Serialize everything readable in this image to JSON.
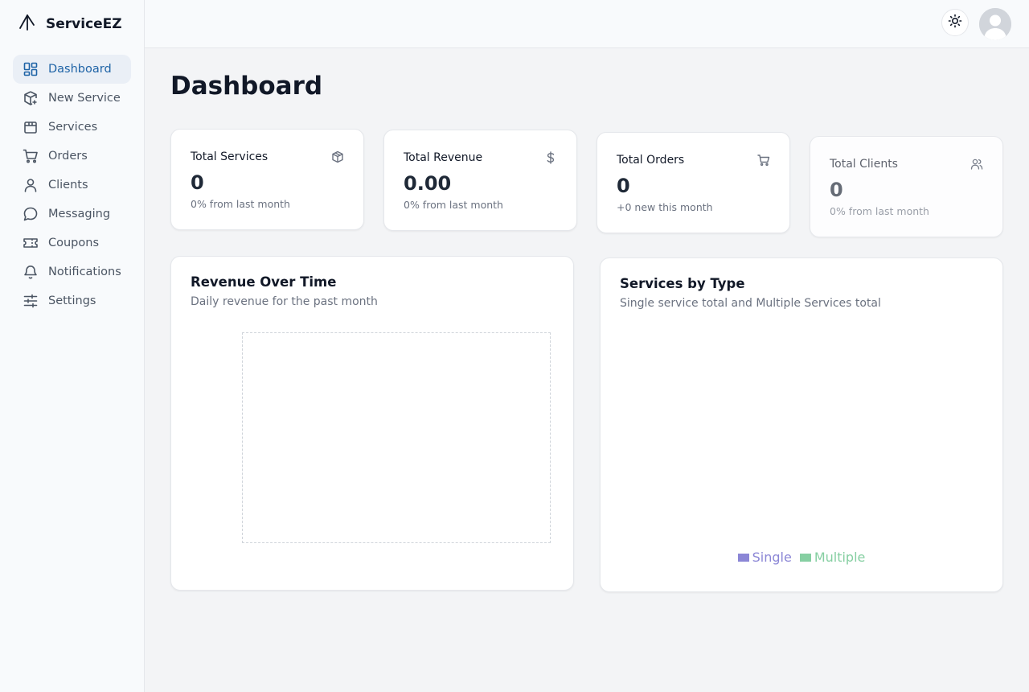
{
  "app": {
    "name": "ServiceEZ"
  },
  "sidebar": {
    "items": [
      {
        "label": "Dashboard",
        "icon": "dashboard-icon",
        "active": true
      },
      {
        "label": "New Service",
        "icon": "package-plus-icon"
      },
      {
        "label": "Services",
        "icon": "store-icon"
      },
      {
        "label": "Orders",
        "icon": "cart-icon"
      },
      {
        "label": "Clients",
        "icon": "user-icon"
      },
      {
        "label": "Messaging",
        "icon": "message-icon"
      },
      {
        "label": "Coupons",
        "icon": "ticket-icon"
      },
      {
        "label": "Notifications",
        "icon": "bell-icon"
      },
      {
        "label": "Settings",
        "icon": "sliders-icon"
      }
    ]
  },
  "header": {
    "theme_icon": "sun-icon",
    "avatar_icon": "user-avatar-icon"
  },
  "page": {
    "title": "Dashboard"
  },
  "stats": [
    {
      "label": "Total Services",
      "value": "0",
      "sub": "0% from last month",
      "icon": "package-icon"
    },
    {
      "label": "Total Revenue",
      "value": "0.00",
      "sub": "0% from last month",
      "icon": "dollar-icon"
    },
    {
      "label": "Total Orders",
      "value": "0",
      "sub": "+0 new this month",
      "icon": "cart-icon"
    },
    {
      "label": "Total Clients",
      "value": "0",
      "sub": "0% from last month",
      "icon": "users-icon"
    }
  ],
  "revenue_panel": {
    "title": "Revenue Over Time",
    "description": "Daily revenue for the past month"
  },
  "services_panel": {
    "title": "Services by Type",
    "description": "Single service total and Multiple Services total",
    "legend": [
      {
        "label": "Single",
        "color": "#8b86d6"
      },
      {
        "label": "Multiple",
        "color": "#86cfa2"
      }
    ]
  },
  "colors": {
    "accent": "#1e63a6",
    "active_bg": "#eaeff6"
  }
}
